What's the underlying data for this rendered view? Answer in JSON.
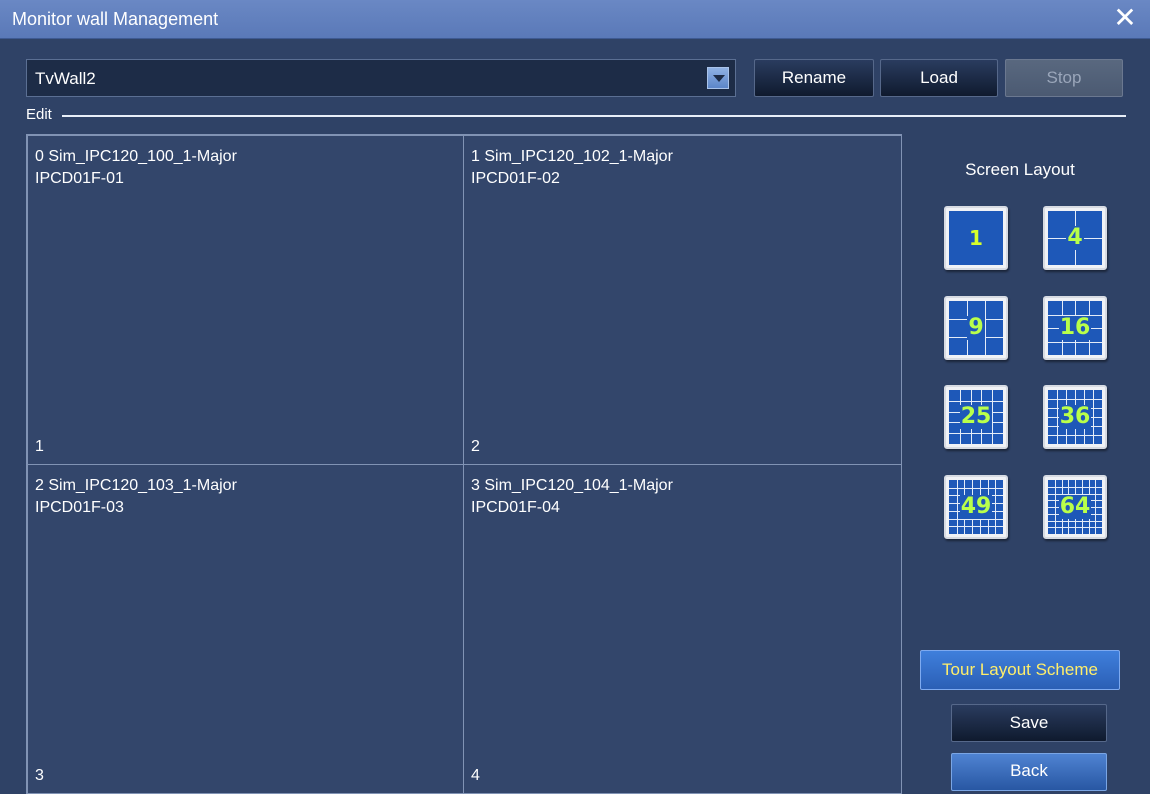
{
  "window": {
    "title": "Monitor wall Management",
    "close_glyph": "✕"
  },
  "toolbar": {
    "wall_name": "TvWall2",
    "rename_label": "Rename",
    "load_label": "Load",
    "stop_label": "Stop"
  },
  "edit": {
    "label": "Edit"
  },
  "cells": [
    {
      "line1": "0  Sim_IPC120_100_1-Major",
      "line2": "IPCD01F-01",
      "number": "1"
    },
    {
      "line1": "1  Sim_IPC120_102_1-Major",
      "line2": "IPCD01F-02",
      "number": "2"
    },
    {
      "line1": "2  Sim_IPC120_103_1-Major",
      "line2": "IPCD01F-03",
      "number": "3"
    },
    {
      "line1": "3  Sim_IPC120_104_1-Major",
      "line2": "IPCD01F-04",
      "number": "4"
    }
  ],
  "screen_layout": {
    "title": "Screen Layout",
    "options": [
      {
        "label": "1",
        "divisions": 1
      },
      {
        "label": "4",
        "divisions": 2
      },
      {
        "label": "9",
        "divisions": 3
      },
      {
        "label": "16",
        "divisions": 4
      },
      {
        "label": "25",
        "divisions": 5
      },
      {
        "label": "36",
        "divisions": 6
      },
      {
        "label": "49",
        "divisions": 7
      },
      {
        "label": "64",
        "divisions": 8
      }
    ]
  },
  "actions": {
    "tour_label": "Tour Layout Scheme",
    "save_label": "Save",
    "back_label": "Back"
  },
  "colors": {
    "layout_icon_bg": "#1e58b8",
    "layout_icon_grid": "#e4ecf8",
    "layout_icon_number": "#b9ff4a",
    "tour_text": "#ffee6a"
  }
}
